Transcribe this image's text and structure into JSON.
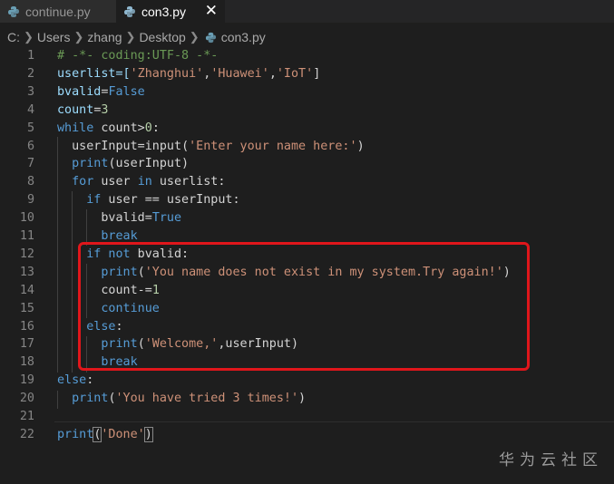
{
  "tabs": [
    {
      "label": "continue.py",
      "active": false
    },
    {
      "label": "con3.py",
      "active": true,
      "close": "✕"
    }
  ],
  "breadcrumb": [
    "C:",
    "Users",
    "zhang",
    "Desktop",
    "con3.py"
  ],
  "colors": {
    "keyword": "#569cd6",
    "string": "#ce9178",
    "number": "#b5cea8",
    "comment": "#6a9955",
    "highlight": "#e0161b"
  },
  "lines": [
    [
      {
        "t": "# -*- coding:UTF-8 -*-",
        "c": "cm"
      }
    ],
    [
      {
        "t": "userlist=[",
        "c": "var"
      },
      {
        "t": "'Zhanghui'",
        "c": "str"
      },
      {
        "t": ",",
        "c": ""
      },
      {
        "t": "'Huawei'",
        "c": "str"
      },
      {
        "t": ",",
        "c": ""
      },
      {
        "t": "'IoT'",
        "c": "str"
      },
      {
        "t": "]",
        "c": ""
      }
    ],
    [
      {
        "t": "bvalid",
        "c": "var"
      },
      {
        "t": "=",
        "c": ""
      },
      {
        "t": "False",
        "c": "kw"
      }
    ],
    [
      {
        "t": "count",
        "c": "var"
      },
      {
        "t": "=",
        "c": ""
      },
      {
        "t": "3",
        "c": "num"
      }
    ],
    [
      {
        "t": "while",
        "c": "ctl"
      },
      {
        "t": " count>",
        "c": ""
      },
      {
        "t": "0",
        "c": "num"
      },
      {
        "t": ":",
        "c": ""
      }
    ],
    [
      {
        "t": "  userInput=",
        "c": ""
      },
      {
        "t": "input",
        "c": ""
      },
      {
        "t": "(",
        "c": ""
      },
      {
        "t": "'Enter your name here:'",
        "c": "str"
      },
      {
        "t": ")",
        "c": ""
      }
    ],
    [
      {
        "t": "  ",
        "c": ""
      },
      {
        "t": "print",
        "c": "kw"
      },
      {
        "t": "(userInput)",
        "c": ""
      }
    ],
    [
      {
        "t": "  ",
        "c": ""
      },
      {
        "t": "for",
        "c": "ctl"
      },
      {
        "t": " user ",
        "c": ""
      },
      {
        "t": "in",
        "c": "ctl"
      },
      {
        "t": " userlist:",
        "c": ""
      }
    ],
    [
      {
        "t": "    ",
        "c": ""
      },
      {
        "t": "if",
        "c": "ctl"
      },
      {
        "t": " user == userInput:",
        "c": ""
      }
    ],
    [
      {
        "t": "      bvalid=",
        "c": ""
      },
      {
        "t": "True",
        "c": "kw"
      }
    ],
    [
      {
        "t": "      ",
        "c": ""
      },
      {
        "t": "break",
        "c": "ctl"
      }
    ],
    [
      {
        "t": "    ",
        "c": ""
      },
      {
        "t": "if not",
        "c": "ctl"
      },
      {
        "t": " bvalid:",
        "c": ""
      }
    ],
    [
      {
        "t": "      ",
        "c": ""
      },
      {
        "t": "print",
        "c": "kw"
      },
      {
        "t": "(",
        "c": ""
      },
      {
        "t": "'You name does not exist in my system.Try again!'",
        "c": "str"
      },
      {
        "t": ")",
        "c": ""
      }
    ],
    [
      {
        "t": "      count-=",
        "c": ""
      },
      {
        "t": "1",
        "c": "num"
      }
    ],
    [
      {
        "t": "      ",
        "c": ""
      },
      {
        "t": "continue",
        "c": "ctl"
      }
    ],
    [
      {
        "t": "    ",
        "c": ""
      },
      {
        "t": "else",
        "c": "ctl"
      },
      {
        "t": ":",
        "c": ""
      }
    ],
    [
      {
        "t": "      ",
        "c": ""
      },
      {
        "t": "print",
        "c": "kw"
      },
      {
        "t": "(",
        "c": ""
      },
      {
        "t": "'Welcome,'",
        "c": "str"
      },
      {
        "t": ",userInput)",
        "c": ""
      }
    ],
    [
      {
        "t": "      ",
        "c": ""
      },
      {
        "t": "break",
        "c": "ctl"
      }
    ],
    [
      {
        "t": "else",
        "c": "ctl"
      },
      {
        "t": ":",
        "c": ""
      }
    ],
    [
      {
        "t": "  ",
        "c": ""
      },
      {
        "t": "print",
        "c": "kw"
      },
      {
        "t": "(",
        "c": ""
      },
      {
        "t": "'You have tried 3 times!'",
        "c": "str"
      },
      {
        "t": ")",
        "c": ""
      }
    ],
    [],
    [
      {
        "t": "print",
        "c": "kw"
      },
      {
        "t": "(",
        "c": "cur"
      },
      {
        "t": "'Done'",
        "c": "str"
      },
      {
        "t": ")",
        "c": "cur"
      }
    ]
  ],
  "watermark": "华为云社区"
}
